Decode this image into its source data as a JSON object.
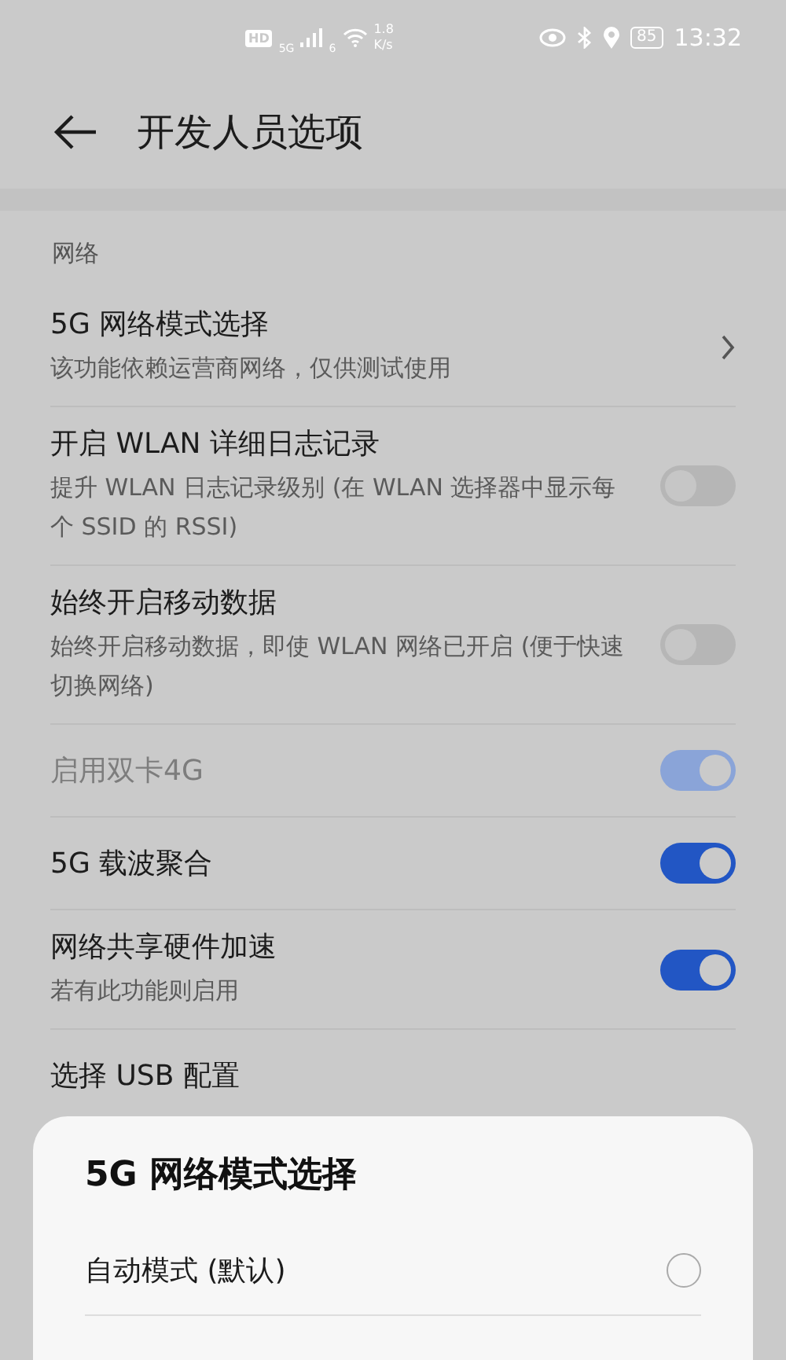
{
  "status_bar": {
    "hd": "HD",
    "network": "5G",
    "wifi_badge": "6",
    "speed": [
      "1.8",
      "K/s"
    ],
    "battery": "85",
    "time": "13:32"
  },
  "header": {
    "title": "开发人员选项"
  },
  "section": "网络",
  "items": [
    {
      "kind": "chevron",
      "title": "5G 网络模式选择",
      "subtitle": "该功能依赖运营商网络，仅供测试使用"
    },
    {
      "kind": "toggle",
      "title": "开启 WLAN 详细日志记录",
      "subtitle": "提升 WLAN 日志记录级别 (在 WLAN 选择器中显示每个 SSID 的 RSSI)",
      "on": false,
      "disabled": false
    },
    {
      "kind": "toggle",
      "title": "始终开启移动数据",
      "subtitle": "始终开启移动数据，即使 WLAN 网络已开启 (便于快速切换网络)",
      "on": false,
      "disabled": false
    },
    {
      "kind": "toggle",
      "title": "启用双卡4G",
      "on": true,
      "disabled": true
    },
    {
      "kind": "toggle",
      "title": "5G 载波聚合",
      "on": true,
      "disabled": false
    },
    {
      "kind": "toggle",
      "title": "网络共享硬件加速",
      "subtitle": "若有此功能则启用",
      "on": true,
      "disabled": false
    },
    {
      "kind": "plain",
      "title": "选择 USB 配置"
    }
  ],
  "sheet": {
    "title": "5G 网络模式选择",
    "options": [
      {
        "label": "自动模式 (默认)",
        "selected": false
      }
    ]
  }
}
